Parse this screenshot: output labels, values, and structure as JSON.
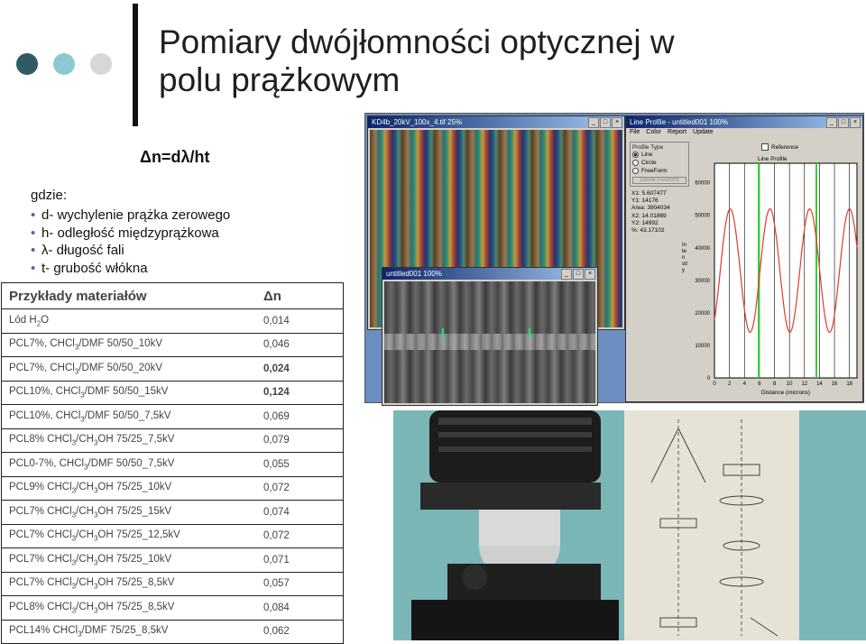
{
  "title_line1": "Pomiary dwójłomności optycznej w",
  "title_line2": "polu prążkowym",
  "formula": "Δn=dλ/ht",
  "where_label": "gdzie:",
  "definitions": [
    "d- wychylenie prążka zerowego",
    "h- odległość międzyprążkowa",
    "λ- długość fali",
    "t- grubość włókna"
  ],
  "table": {
    "header_material": "Przykłady materiałów",
    "header_value": "Δn",
    "rows": [
      {
        "pre": "Lód H",
        "sub": "2",
        "post": "O",
        "post2": "",
        "sub2": "",
        "post3": "",
        "value": "0,014",
        "bold": false
      },
      {
        "pre": "PCL7%, CHCl",
        "sub": "3",
        "post": "/DMF 50/50_10kV",
        "sub2": "",
        "post3": "",
        "value": "0,046",
        "bold": false
      },
      {
        "pre": "PCL7%, CHCl",
        "sub": "3",
        "post": "/DMF 50/50_20kV",
        "sub2": "",
        "post3": "",
        "value": "0,024",
        "bold": true
      },
      {
        "pre": "PCL10%, CHCl",
        "sub": "3",
        "post": "/DMF 50/50_15kV",
        "sub2": "",
        "post3": "",
        "value": "0,124",
        "bold": true
      },
      {
        "pre": "PCL10%, CHCl",
        "sub": "3",
        "post": "/DMF 50/50_7,5kV",
        "sub2": "",
        "post3": "",
        "value": "0,069",
        "bold": false
      },
      {
        "pre": "PCL8% CHCl",
        "sub": "3",
        "post": "/CH",
        "sub2": "3",
        "post3": "OH 75/25_7,5kV",
        "value": "0,079",
        "bold": false
      },
      {
        "pre": "PCL0-7%, CHCl",
        "sub": "3",
        "post": "/DMF 50/50_7,5kV",
        "sub2": "",
        "post3": "",
        "value": "0,055",
        "bold": false
      },
      {
        "pre": "PCL9% CHCl",
        "sub": "3",
        "post": "/CH",
        "sub2": "3",
        "post3": "OH 75/25_10kV",
        "value": "0,072",
        "bold": false
      },
      {
        "pre": "PCL7% CHCl",
        "sub": "3",
        "post": "/CH",
        "sub2": "3",
        "post3": "OH 75/25_15kV",
        "value": "0,074",
        "bold": false
      },
      {
        "pre": "PCL7% CHCl",
        "sub": "3",
        "post": "/CH",
        "sub2": "3",
        "post3": "OH 75/25_12,5kV",
        "value": "0,072",
        "bold": false
      },
      {
        "pre": "PCL7% CHCl",
        "sub": "3",
        "post": "/CH",
        "sub2": "3",
        "post3": "OH 75/25_10kV",
        "value": "0,071",
        "bold": false
      },
      {
        "pre": "PCL7% CHCl",
        "sub": "3",
        "post": "/CH",
        "sub2": "3",
        "post3": "OH 75/25_8,5kV",
        "value": "0,057",
        "bold": false
      },
      {
        "pre": "PCL8% CHCl",
        "sub": "3",
        "post": "/CH",
        "sub2": "3",
        "post3": "OH 75/25_8,5kV",
        "value": "0,084",
        "bold": false
      },
      {
        "pre": "PCL14% CHCl",
        "sub": "3",
        "post": "/DMF 75/25_8,5kV",
        "sub2": "",
        "post3": "",
        "value": "0,062",
        "bold": false
      }
    ]
  },
  "screenshot": {
    "fringe_window_title": "KD4b_20kV_100x_4.tif 25%",
    "gray_window_title": "untitled001 100%",
    "profile_window_title": "Line Profile - untitled001 100%",
    "profile_menu": [
      "File",
      "Color",
      "Report",
      "Update"
    ],
    "profile_type_label": "Profile Type",
    "profile_types": [
      "Line",
      "Circle",
      "FreeForm"
    ],
    "selected_profile_type": "Line",
    "delete_button": "Delete Freeform",
    "reference_label": "Reference",
    "plot_legend": "Line Profile",
    "readouts": [
      "X1: 5.607477",
      "Y1: 14176",
      "Area: 3904034",
      "X2: 14.01869",
      "Y2: 14992",
      "%: 43.17102"
    ],
    "y_axis_label": "Intensity",
    "x_axis_label": "Distance (microns)",
    "y_ticks": [
      "60000",
      "50000",
      "40000",
      "30000",
      "20000",
      "10000",
      "0"
    ],
    "x_ticks": [
      "0",
      "2",
      "4",
      "6",
      "8",
      "10",
      "12",
      "14",
      "16",
      "18"
    ]
  },
  "colors": {
    "dot1": "#2e5b66",
    "dot2": "#8ecad0",
    "dot3": "#d7d7d7",
    "bullet": "#3a6db0",
    "curve": "#e23a2a",
    "marker": "#2ed12e"
  }
}
